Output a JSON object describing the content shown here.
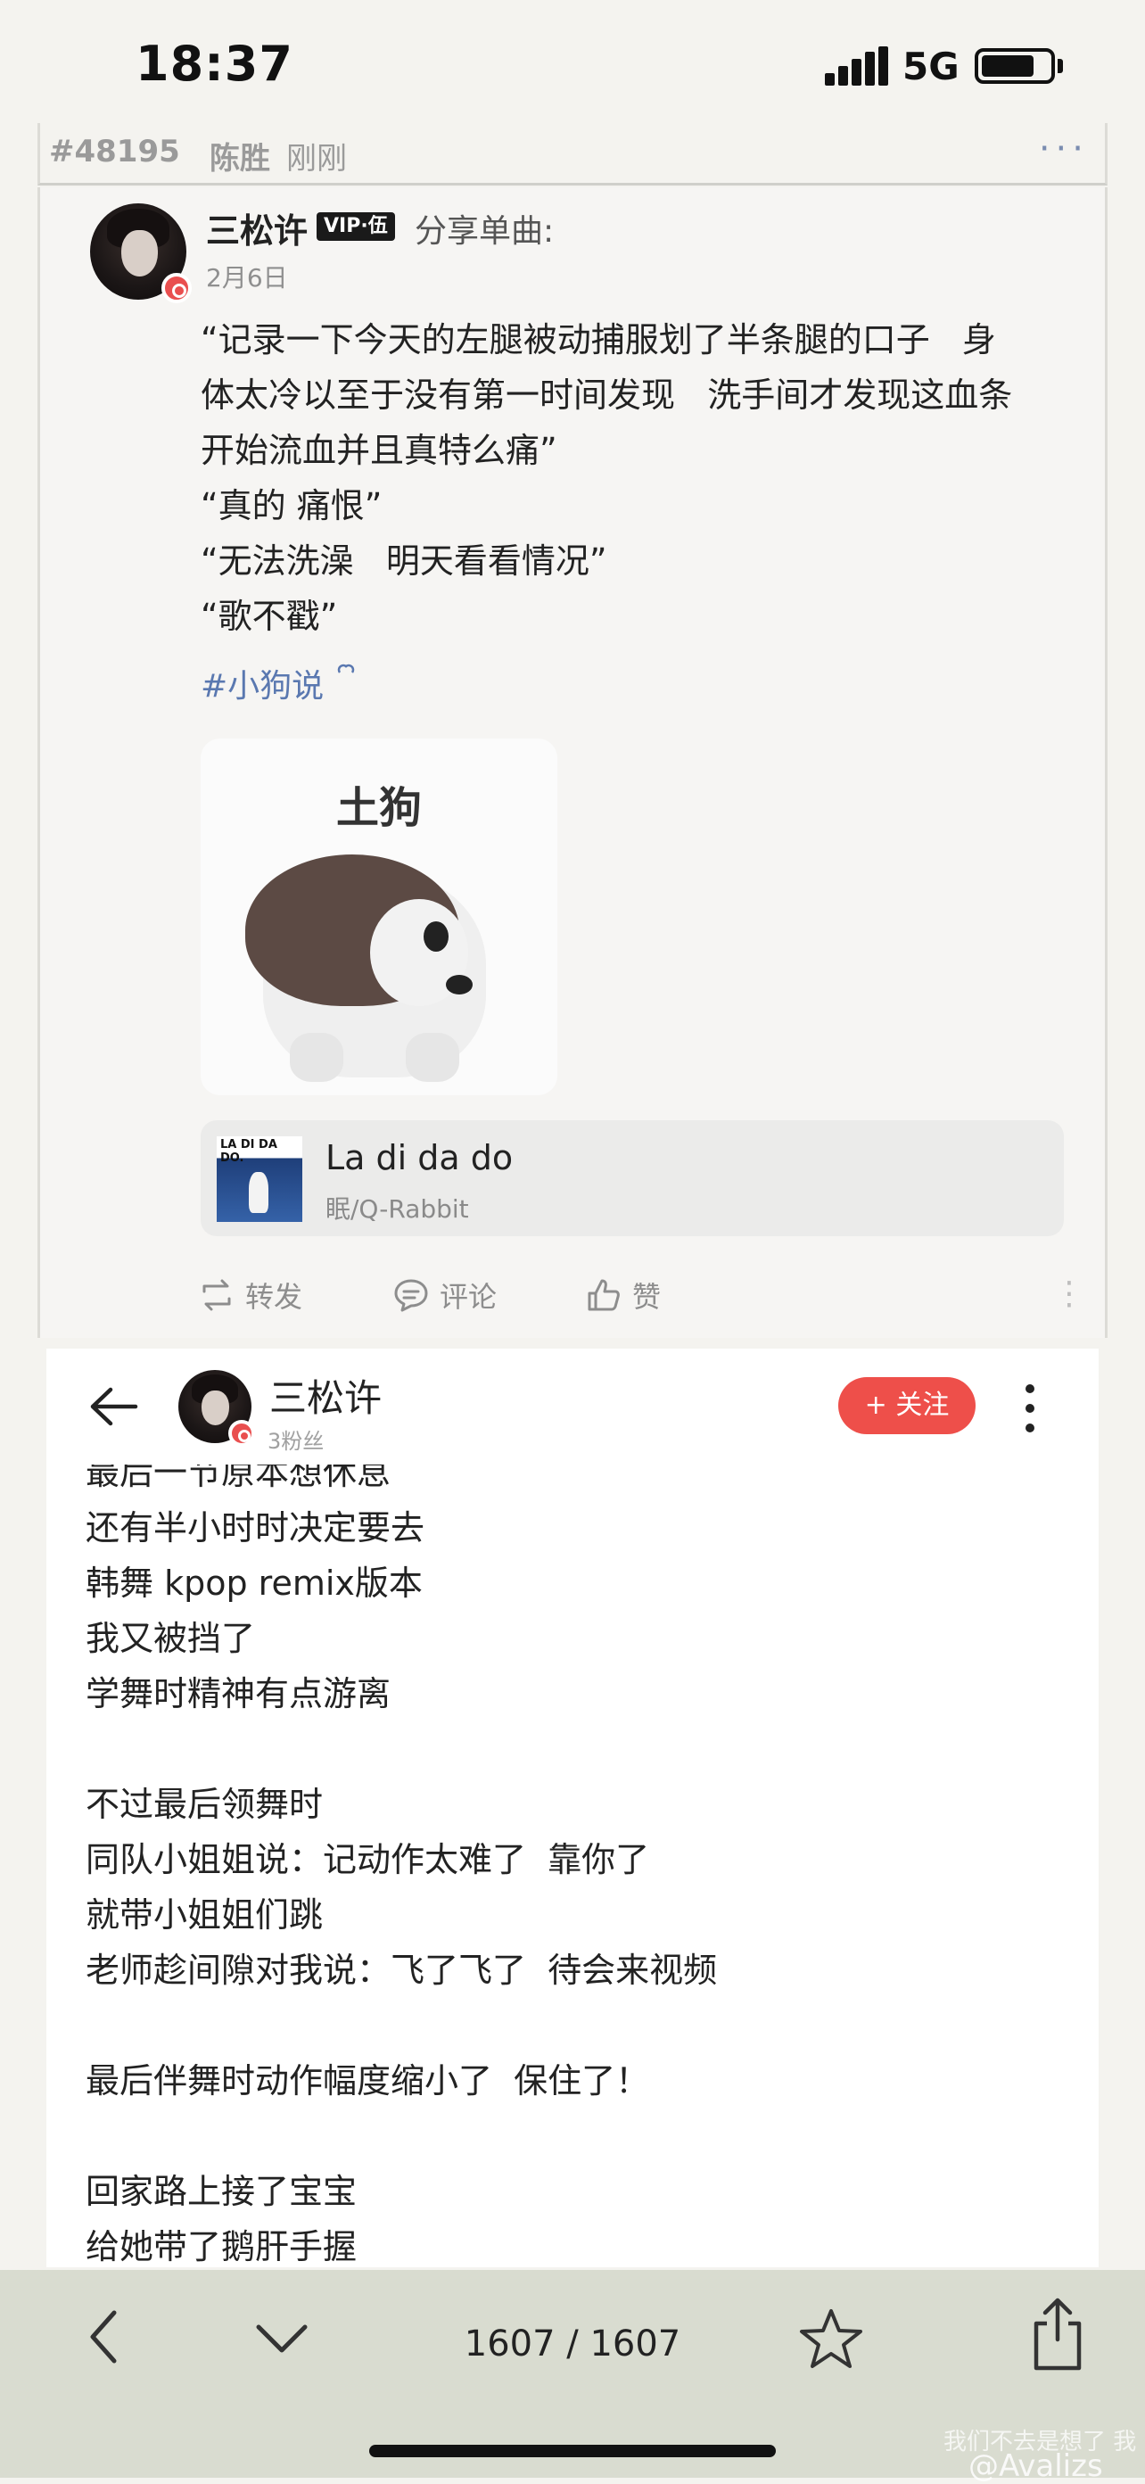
{
  "status_bar": {
    "time": "18:37",
    "network": "5G"
  },
  "post_meta": {
    "id": "#48195",
    "user": "陈胜",
    "time": "刚刚",
    "more": "···"
  },
  "post": {
    "author": "三松许",
    "vip_badge": "VIP·伍",
    "share_label": "分享单曲:",
    "date": "2月6日",
    "lines": [
      "“记录一下今天的左腿被动捕服划了半条腿的口子   身",
      "体太冷以至于没有第一时间发现   洗手间才发现这血条",
      "开始流血并且真特么痛”",
      "“真的 痛恨”",
      "“无法洗澡   明天看看情况”",
      "“歌不戳”"
    ],
    "topic": "#小狗说",
    "sticker_text": "土狗",
    "song": {
      "title": "La di da do",
      "artist": "眠/Q-Rabbit",
      "art_text": "LA DI DA DO."
    },
    "actions": {
      "repost": "转发",
      "comment": "评论",
      "like": "赞"
    }
  },
  "profile": {
    "author": "三松许",
    "followers": "3粉丝",
    "follow_button": "+ 关注",
    "lines": [
      "最后一节原本想休息",
      "还有半小时时决定要去",
      "韩舞 kpop remix版本",
      "我又被挡了",
      "学舞时精神有点游离",
      "",
      "不过最后领舞时",
      "同队小姐姐说：记动作太难了  靠你了",
      "就带小姐姐们跳",
      "老师趁间隙对我说：飞了飞了  待会来视频",
      "",
      "最后伴舞时动作幅度缩小了  保住了！",
      "",
      "回家路上接了宝宝",
      "给她带了鹅肝手握"
    ]
  },
  "toolbar": {
    "page_counter": "1607 / 1607"
  },
  "watermark": {
    "line1": "我们不去是想了 我",
    "line2": "@Avalizs"
  },
  "colors": {
    "accent_red": "#ee4f4a",
    "topic_blue": "#5a78b0",
    "toolbar_bg": "#d9dcd0"
  }
}
